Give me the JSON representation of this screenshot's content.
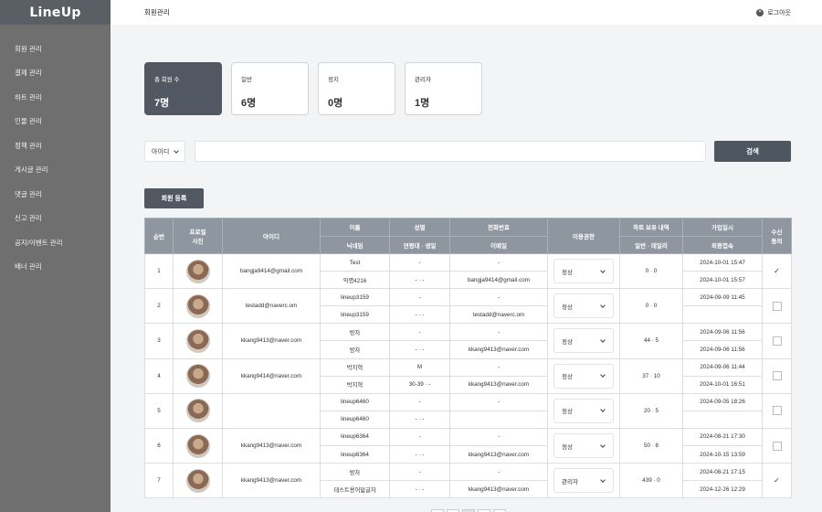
{
  "app": {
    "logo": "LineUp"
  },
  "sidebar": {
    "items": [
      {
        "label": "회원 관리"
      },
      {
        "label": "결제 관리"
      },
      {
        "label": "하트 관리"
      },
      {
        "label": "인물 관리"
      },
      {
        "label": "정책 관리"
      },
      {
        "label": "게시글 관리"
      },
      {
        "label": "댓글 관리"
      },
      {
        "label": "신고 관리"
      },
      {
        "label": "공지/이벤트 관리"
      },
      {
        "label": "배너 관리"
      }
    ]
  },
  "header": {
    "title": "회원관리",
    "logout_label": "로그아웃"
  },
  "stats": [
    {
      "label": "총 회원 수",
      "value": "7명"
    },
    {
      "label": "일반",
      "value": "6명"
    },
    {
      "label": "정지",
      "value": "0명"
    },
    {
      "label": "관리자",
      "value": "1명"
    }
  ],
  "search": {
    "field_select": "아이디",
    "input_value": "",
    "button_label": "검색"
  },
  "register_button": "회원 등록",
  "table": {
    "headers": {
      "no": "순번",
      "photo": "프로필\n사진",
      "id": "아이디",
      "name": "이름",
      "nickname": "닉네임",
      "gender": "성별",
      "age_birth": "연령대 · 생일",
      "phone": "전화번호",
      "email": "이메일",
      "permission": "이용권한",
      "hearts": "하트 보유 내역",
      "hearts_sub": "일반 · 데일리",
      "joined": "가입일시",
      "last_login": "최종접속",
      "receive": "수신\n동의"
    },
    "rows": [
      {
        "no": "1",
        "id": "bangja9414@gmail.com",
        "name": "Test",
        "nickname": "익명4216",
        "gender": "-",
        "age_birth": "- · -",
        "phone": "-",
        "email": "bangja9414@gmail.com",
        "permission": "정상",
        "hearts": "0 · 0",
        "joined": "2024-10-01 15:47",
        "last_login": "2024-10-01 15:57",
        "receive": "✓"
      },
      {
        "no": "2",
        "id": "testadd@naverc.om",
        "name": "lineup3159",
        "nickname": "lineup3159",
        "gender": "-",
        "age_birth": "- · -",
        "phone": "-",
        "email": "testadd@naverc.om",
        "permission": "정상",
        "hearts": "0 · 0",
        "joined": "2024-09-09 11:45",
        "last_login": "",
        "receive": ""
      },
      {
        "no": "3",
        "id": "kkang9413@naver.com",
        "name": "방자",
        "nickname": "방자",
        "gender": "-",
        "age_birth": "- · -",
        "phone": "-",
        "email": "kkang9413@naver.com",
        "permission": "정상",
        "hearts": "44 · 5",
        "joined": "2024-09-06 11:56",
        "last_login": "2024-09-06 11:56",
        "receive": ""
      },
      {
        "no": "4",
        "id": "kkang9414@naver.com",
        "name": "박지혁",
        "nickname": "박지혁",
        "gender": "M",
        "age_birth": "30-39 · -",
        "phone": "-",
        "email": "kkang9413@naver.com",
        "permission": "정상",
        "hearts": "37 · 10",
        "joined": "2024-09-06 11:44",
        "last_login": "2024-10-01 16:51",
        "receive": ""
      },
      {
        "no": "5",
        "id": "",
        "name": "lineup6460",
        "nickname": "lineup6460",
        "gender": "-",
        "age_birth": "- · -",
        "phone": "-",
        "email": "",
        "permission": "정상",
        "hearts": "20 · 5",
        "joined": "2024-09-05 18:26",
        "last_login": "",
        "receive": ""
      },
      {
        "no": "6",
        "id": "kkang9413@naver.com",
        "name": "lineup6364",
        "nickname": "lineup6364",
        "gender": "-",
        "age_birth": "- · -",
        "phone": "-",
        "email": "kkang9413@naver.com",
        "permission": "정상",
        "hearts": "50 · 8",
        "joined": "2024-08-21 17:30",
        "last_login": "2024-10-15 13:59",
        "receive": ""
      },
      {
        "no": "7",
        "id": "kkang9413@naver.com",
        "name": "방자",
        "nickname": "테스트용어덟글자",
        "gender": "-",
        "age_birth": "- · -",
        "phone": "-",
        "email": "kkang9413@naver.com",
        "permission": "관리자",
        "hearts": "439 · 0",
        "joined": "2024-08-21 17:15",
        "last_login": "2024-12-26 12:29",
        "receive": "✓"
      }
    ]
  }
}
